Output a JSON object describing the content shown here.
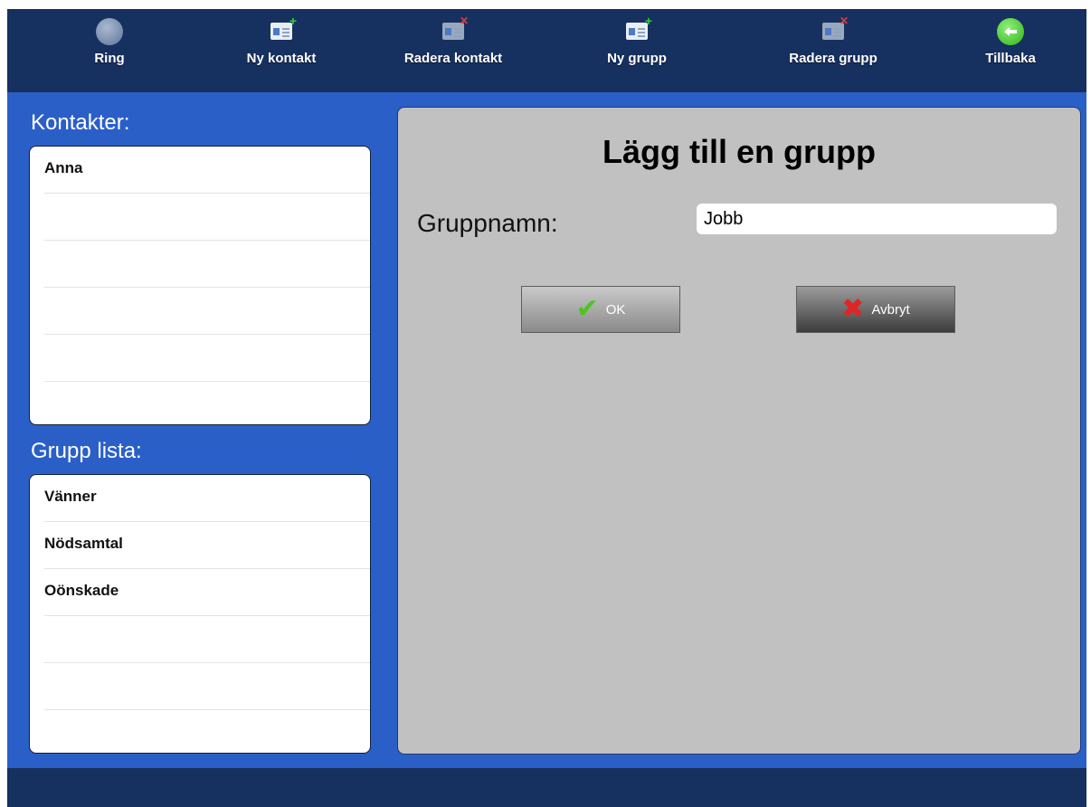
{
  "toolbar": {
    "items": [
      {
        "label": "Ring",
        "icon": "phone-icon"
      },
      {
        "label": "Ny kontakt",
        "icon": "add-contact-icon"
      },
      {
        "label": "Radera kontakt",
        "icon": "delete-contact-icon"
      },
      {
        "label": "Ny grupp",
        "icon": "add-group-icon"
      },
      {
        "label": "Radera grupp",
        "icon": "delete-group-icon"
      },
      {
        "label": "Tillbaka",
        "icon": "back-arrow-icon"
      }
    ]
  },
  "contacts": {
    "title": "Kontakter:",
    "items": [
      "Anna",
      "",
      "",
      "",
      "",
      ""
    ]
  },
  "groups": {
    "title": "Grupp lista:",
    "items": [
      "Vänner",
      "Nödsamtal",
      "Oönskade",
      "",
      "",
      ""
    ]
  },
  "dialog": {
    "title": "Lägg till en grupp",
    "field_label": "Gruppnamn:",
    "field_value": "Jobb",
    "ok_label": "OK",
    "cancel_label": "Avbryt"
  },
  "colors": {
    "topbar": "#16305f",
    "background": "#2b5fc8",
    "panel": "#c1c1c1"
  }
}
